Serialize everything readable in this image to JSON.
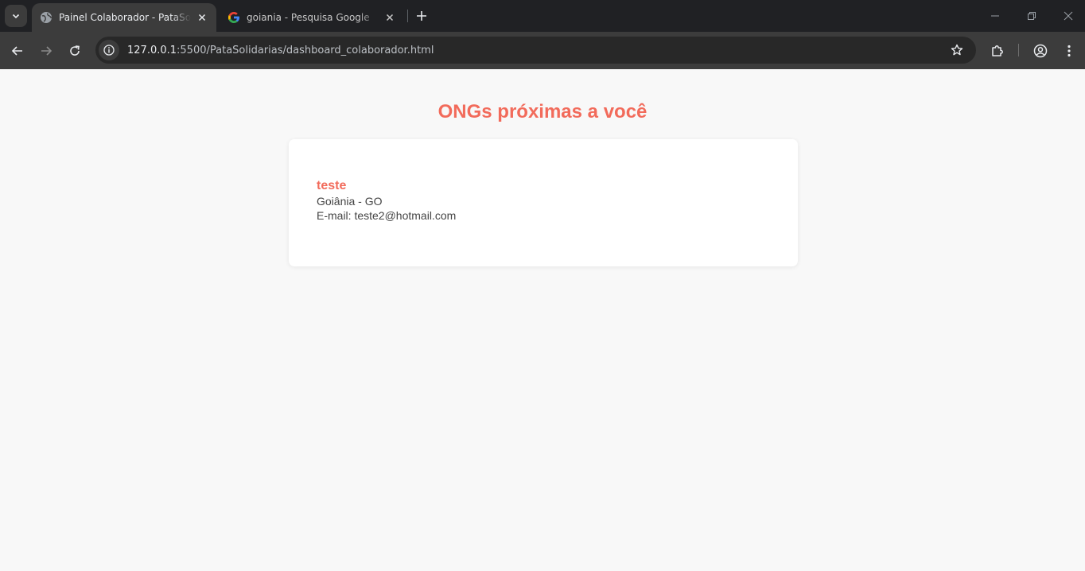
{
  "browser": {
    "tabs": [
      {
        "title": "Painel Colaborador - PataSolidárias",
        "active": true,
        "favicon": "globe-icon"
      },
      {
        "title": "goiania - Pesquisa Google",
        "active": false,
        "favicon": "google-icon"
      }
    ],
    "url": {
      "host": "127.0.0.1",
      "rest": ":5500/PataSolidarias/dashboard_colaborador.html"
    }
  },
  "page": {
    "title": "ONGs próximas a você",
    "ongs": [
      {
        "name": "teste",
        "location": "Goiânia - GO",
        "email": "E-mail: teste2@hotmail.com"
      }
    ]
  },
  "colors": {
    "accent": "#f26b5b",
    "chrome_dark": "#202124",
    "toolbar": "#3c3c3c",
    "page_bg": "#f8f8f8"
  }
}
